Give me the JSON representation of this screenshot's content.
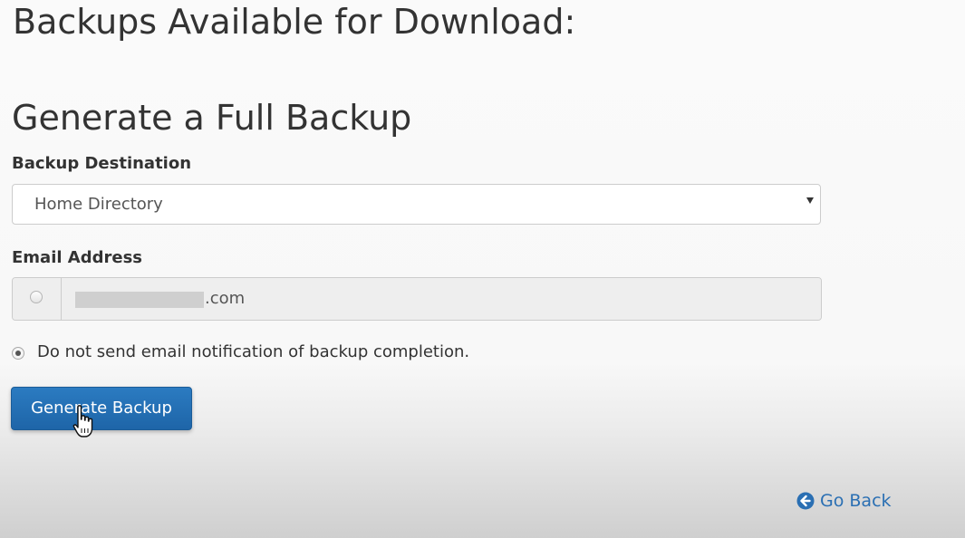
{
  "headings": {
    "available": "Backups Available for Download:",
    "generate": "Generate a Full Backup"
  },
  "form": {
    "destination_label": "Backup Destination",
    "destination_value": "Home Directory",
    "email_label": "Email Address",
    "email_suffix": ".com",
    "no_email_option": "Do not send email notification of backup completion.",
    "no_email_selected": true,
    "generate_button": "Generate Backup"
  },
  "footer": {
    "go_back": "Go Back",
    "go_back_icon": "arrow-circle-left-icon"
  },
  "colors": {
    "primary_button": "#2370b5",
    "link": "#2a6fb3"
  }
}
